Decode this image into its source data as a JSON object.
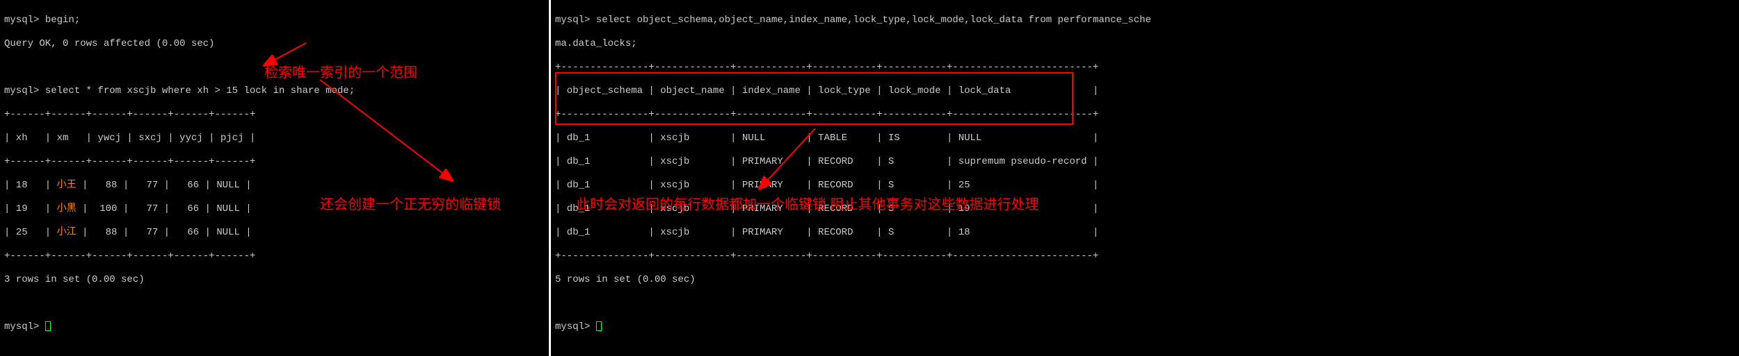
{
  "left": {
    "prompt": "mysql>",
    "l1_cmd": " begin;",
    "l2": "Query OK, 0 rows affected (0.00 sec)",
    "l3_cmd": " select * from xscjb where xh > 15 lock in share mode;",
    "table_border_top": "+------+------+------+------+------+------+",
    "table_header": "| xh   | xm   | ywcj | sxcj | yycj | pjcj |",
    "table_border_mid": "+------+------+------+------+------+------+",
    "row1_pre": "| 18   | ",
    "row1_name": "小王",
    "row1_post": " |   88 |   77 |   66 | NULL |",
    "row2_pre": "| 19   | ",
    "row2_name": "小黑",
    "row2_post": " |  100 |   77 |   66 | NULL |",
    "row3_pre": "| 25   | ",
    "row3_name": "小江",
    "row3_post": " |   88 |   77 |   66 | NULL |",
    "table_border_bot": "+------+------+------+------+------+------+",
    "result": "3 rows in set (0.00 sec)",
    "annotation1": "检索唯一索引的一个范围",
    "annotation2": "还会创建一个正无穷的临键锁"
  },
  "right": {
    "prompt": "mysql>",
    "l1_cmd": " select object_schema,object_name,index_name,lock_type,lock_mode,lock_data from performance_sche",
    "l1_wrap": "ma.data_locks;",
    "table_border": "+---------------+-------------+------------+-----------+-----------+------------------------+",
    "table_header": "| object_schema | object_name | index_name | lock_type | lock_mode | lock_data              |",
    "row1": "| db_1          | xscjb       | NULL       | TABLE     | IS        | NULL                   |",
    "row2": "| db_1          | xscjb       | PRIMARY    | RECORD    | S         | supremum pseudo-record |",
    "row3": "| db_1          | xscjb       | PRIMARY    | RECORD    | S         | 25                     |",
    "row4": "| db_1          | xscjb       | PRIMARY    | RECORD    | S         | 19                     |",
    "row5": "| db_1          | xscjb       | PRIMARY    | RECORD    | S         | 18                     |",
    "result": "5 rows in set (0.00 sec)",
    "annotation": "此时会对返回的每行数据都加一个临键锁 阻止其他事务对这些数据进行处理"
  }
}
